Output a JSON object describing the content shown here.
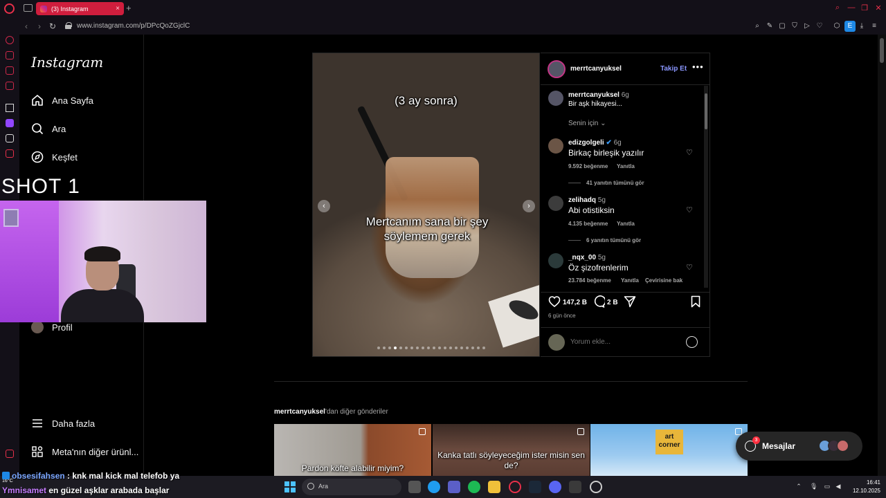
{
  "browser": {
    "tab_title": "(3) Instagram",
    "url": "www.instagram.com/p/DPcQoZGjclC",
    "extension_badge": "E"
  },
  "nav": {
    "logo": "Instagram",
    "items": [
      {
        "label": "Ana Sayfa",
        "icon": "home-icon"
      },
      {
        "label": "Ara",
        "icon": "search-icon"
      },
      {
        "label": "Keşfet",
        "icon": "compass-icon"
      },
      {
        "label": "Profil",
        "icon": "avatar"
      }
    ],
    "more": "Daha fazla",
    "meta": "Meta'nın diğer ürünl..."
  },
  "post": {
    "username": "merrtcanyuksel",
    "follow": "Takip Et",
    "image_text_top": "(3 ay sonra)",
    "image_text_mid": "Mertcanım sana bir şey söylemem gerek",
    "caption_user": "merrtcanyuksel",
    "caption_time": "6g",
    "caption": "Bir aşk hikayesi...",
    "sort_label": "Senin için",
    "comments": [
      {
        "user": "edizgolgeli",
        "verified": true,
        "time": "6g",
        "text": "Birkaç birleşik yazılır",
        "likes": "9.592 beğenme",
        "reply": "Yanıtla",
        "replies": "41 yanıtın tümünü gör"
      },
      {
        "user": "zelihadq",
        "verified": false,
        "time": "5g",
        "text": "Abi otistiksin",
        "likes": "4.135 beğenme",
        "reply": "Yanıtla",
        "replies": "6 yanıtın tümünü gör"
      },
      {
        "user": "_nqx_00",
        "verified": false,
        "time": "5g",
        "text": "Öz şizofrenlerim",
        "likes": "23.784 beğenme",
        "reply": "Yanıtla",
        "translate": "Çevirisine bak"
      }
    ],
    "like_count": "147,2 B",
    "comment_count": "2 B",
    "posted": "6 gün önce",
    "comment_placeholder": "Yorum ekle..."
  },
  "more_posts": {
    "user": "merrtcanyuksel",
    "suffix": "'dan diğer gönderiler",
    "thumbs": [
      {
        "text": "Pardon köfte alabilir miyim?"
      },
      {
        "text": "Kanka tatlı söyleyeceğim ister misin sen de?"
      },
      {
        "text": "art corner"
      }
    ]
  },
  "messages": {
    "label": "Mesajlar",
    "badge": "3"
  },
  "overlay": {
    "shot_label": "SHOT 1",
    "chat": [
      {
        "user": "obsesifahsen",
        "text": ": knk mal kick mal telefob ya"
      },
      {
        "user": "Ymnisamet",
        "text": "en güzel aşklar arabada başlar"
      }
    ]
  },
  "taskbar": {
    "search_label": "Ara",
    "weather": "16°C",
    "time": "16:41",
    "date": "12.10.2025"
  }
}
